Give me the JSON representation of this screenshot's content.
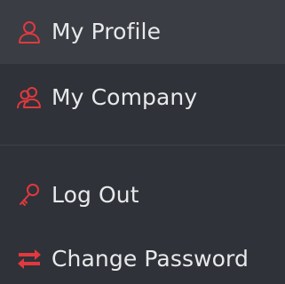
{
  "accent_color": "#e0393f",
  "menu": {
    "items": [
      {
        "label": "My Profile",
        "icon": "user-icon"
      },
      {
        "label": "My Company",
        "icon": "users-icon"
      },
      {
        "label": "Log Out",
        "icon": "key-icon"
      },
      {
        "label": "Change Password",
        "icon": "swap-arrows-icon"
      }
    ]
  }
}
